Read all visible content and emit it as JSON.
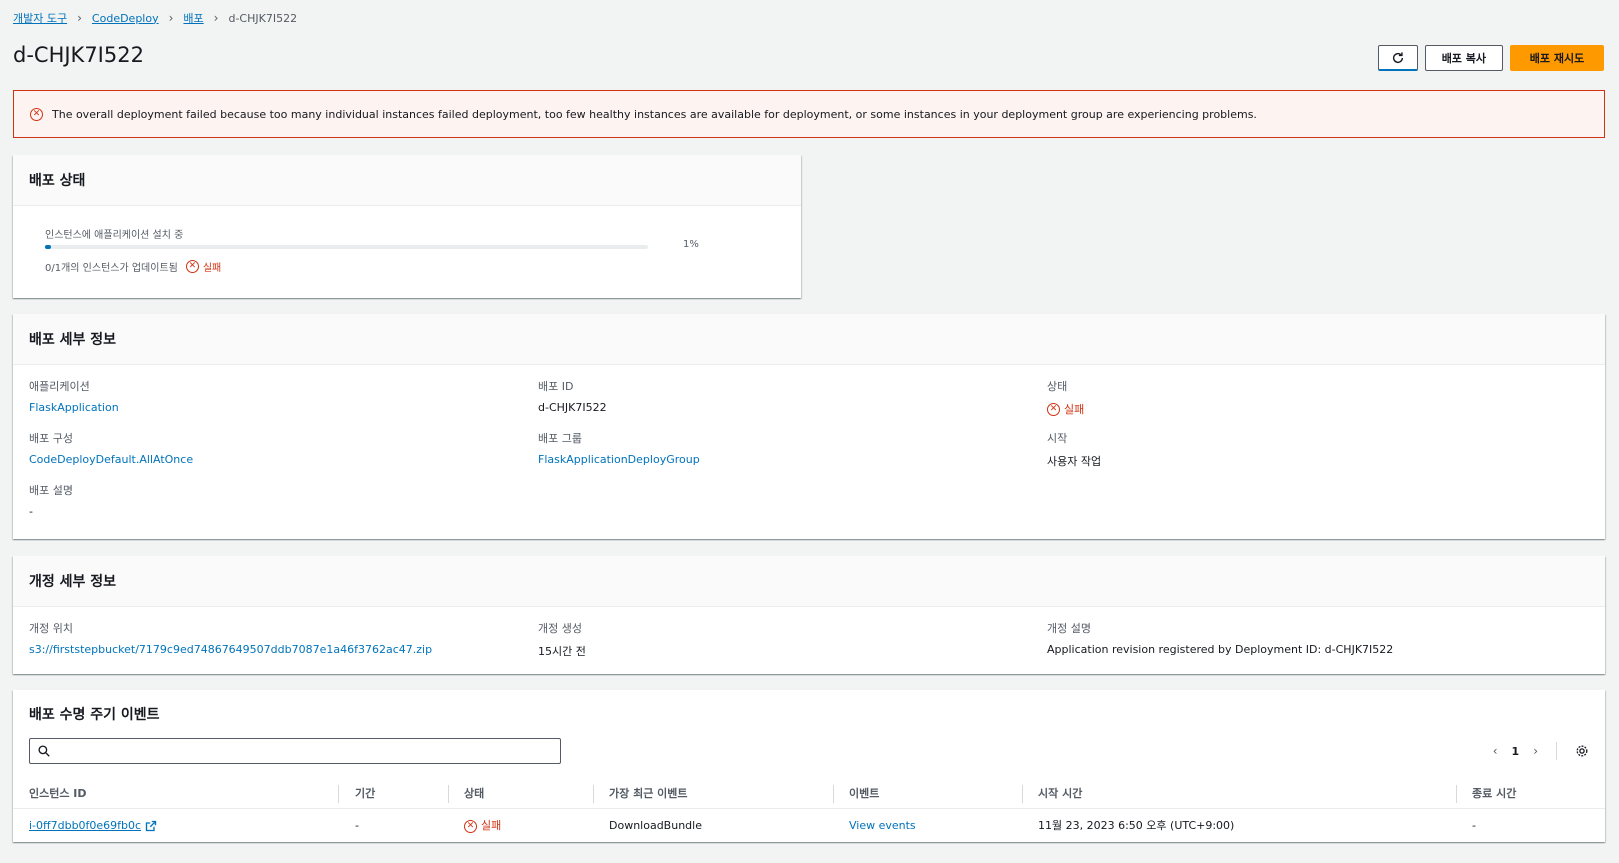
{
  "breadcrumb": {
    "items": [
      "개발자 도구",
      "CodeDeploy",
      "배포"
    ],
    "current": "d-CHJK7I522"
  },
  "page": {
    "title": "d-CHJK7I522"
  },
  "actions": {
    "copy": "배포 복사",
    "retry": "배포 재시도"
  },
  "alert": {
    "message": "The overall deployment failed because too many individual instances failed deployment, too few healthy instances are available for deployment, or some instances in your deployment group are experiencing problems."
  },
  "status_panel": {
    "title": "배포 상태",
    "progress_label": "인스턴스에 애플리케이션 설치 중",
    "progress_percent_text": "1%",
    "progress_value": 0.01,
    "instances_updated": "0/1개의 인스턴스가 업데이트됨",
    "fail_label": "실패"
  },
  "details_panel": {
    "title": "배포 세부 정보",
    "application_label": "애플리케이션",
    "application_value": "FlaskApplication",
    "deployment_id_label": "배포 ID",
    "deployment_id_value": "d-CHJK7I522",
    "status_label": "상태",
    "status_value": "실패",
    "config_label": "배포 구성",
    "config_value": "CodeDeployDefault.AllAtOnce",
    "group_label": "배포 그룹",
    "group_value": "FlaskApplicationDeployGroup",
    "start_label": "시작",
    "start_value": "사용자 작업",
    "description_label": "배포 설명",
    "description_value": "-"
  },
  "revision_panel": {
    "title": "개정 세부 정보",
    "location_label": "개정 위치",
    "location_value": "s3://firststepbucket/7179c9ed74867649507ddb7087e1a46f3762ac47.zip",
    "created_label": "개정 생성",
    "created_value": "15시간 전",
    "description_label": "개정 설명",
    "description_value": "Application revision registered by Deployment ID: d-CHJK7I522"
  },
  "events_panel": {
    "title": "배포 수명 주기 이벤트",
    "search_placeholder": "",
    "page_number": "1",
    "columns": [
      "인스턴스 ID",
      "기간",
      "상태",
      "가장 최근 이벤트",
      "이벤트",
      "시작 시간",
      "종료 시간"
    ],
    "rows": [
      {
        "instance_id": "i-0ff7dbb0f0e69fb0c",
        "duration": "-",
        "status": "실패",
        "latest_event": "DownloadBundle",
        "events": "View events",
        "start_time": "11월 23, 2023 6:50 오후 (UTC+9:00)",
        "end_time": "-"
      }
    ]
  },
  "colors": {
    "link": "#0073bb",
    "error": "#d13212",
    "primary": "#ff9900"
  }
}
